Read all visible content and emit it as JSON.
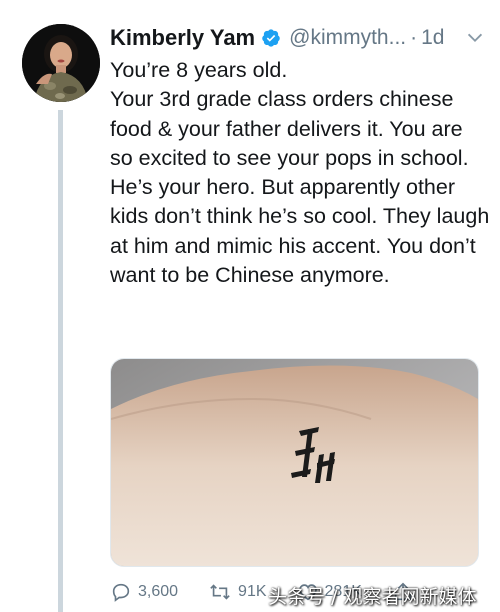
{
  "tweet": {
    "author": {
      "name": "Kimberly Yam",
      "handle": "@kimmyth...",
      "verified": true
    },
    "separator": "·",
    "time": "1d",
    "lines": [
      "You’re 8 years old.",
      "Your 3rd grade class orders chinese food & your father delivers it. You are so excited to see your pops in school. He’s your hero. But apparently other kids don’t think he’s so cool. They laugh at him and mimic his accent. You don’t want to be Chinese anymore."
    ],
    "media": {
      "description_icon": "photo-wrist-tattoo"
    },
    "actions": {
      "replies": "3,600",
      "retweets": "91K",
      "likes": "281K"
    }
  },
  "watermark": "头条号 / 观察者网新媒体",
  "colors": {
    "text": "#14171a",
    "secondary": "#657786",
    "verified": "#1da1f2",
    "thread_line": "#ccd6dd"
  }
}
